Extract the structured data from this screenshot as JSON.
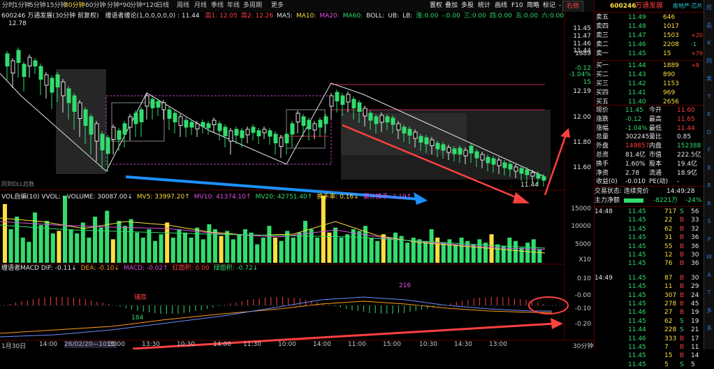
{
  "toolbar": {
    "periods": [
      "分时",
      "1分钟",
      "5分钟",
      "15分钟",
      "30分钟",
      "60分钟",
      "分钟*90",
      "分钟*120",
      "日线",
      "周线",
      "月线",
      "季线",
      "年线",
      "多周期",
      "更多"
    ],
    "selected_period": "30分钟",
    "right_buttons": [
      "置权",
      "叠加",
      "多股",
      "统计",
      "画线",
      "F10",
      "简略",
      "标记",
      "-",
      "+"
    ],
    "right_tab": "右侧"
  },
  "chart": {
    "stock_line": "600246 万通发展(30分钟 前复权)",
    "indicator_line": "缠语者缠论(1,0,0,0,0,0) : 11.44",
    "ma_labels": [
      "高1: 12.05",
      "高2: 12.26",
      "MA5:",
      "MA10:",
      "MA20:",
      "MA60:",
      "BOLL:",
      "UB:",
      "LB:",
      "涨:0.00",
      "-:0.00",
      "三:0.00",
      "四:0.00",
      "五:0.00",
      "六:0.00"
    ],
    "price_high": "12.78",
    "current_tag": "11.44",
    "y_labels": [
      "11.45",
      "11.47",
      "11.46",
      "11.44",
      "1889",
      "-0.12",
      "-1.04%",
      "15",
      "12.19",
      "12.00",
      "11.80",
      "11.60"
    ],
    "bottom_left_label": "同到DLL后数",
    "vol_line": [
      "VOL自编(10) VVOL: - VOLUME: 30087.00↓",
      "MV5: 33997.20↑",
      "MV10: 41374.10↑",
      "MV20: 42751.40↑",
      "换手率: 0.16↓",
      "累计换手: 2.19↑"
    ],
    "vol_y_labels": [
      "15000",
      "10000",
      "5000",
      "X10"
    ],
    "macd_line": [
      "缠语者MACD DIF: -0.11↓",
      "DEA: -0.10↓",
      "MACD: -0.02↑",
      "红面积: 0.00",
      "绿面积: -0.72↓"
    ],
    "macd_y_labels": [
      "0.10",
      "-0.00",
      "-0.10",
      "-0.20"
    ],
    "macd_annotations": {
      "top": "216",
      "bottom": "184",
      "top_left": "铺底"
    },
    "x_labels": [
      "1月30日",
      "14:00",
      "26/02/20—10:30",
      "15:00",
      "13:30",
      "10:30",
      "14:00",
      "11:30",
      "10:00",
      "14:00",
      "11:00",
      "15:00",
      "10:30",
      "14:30",
      "13:00",
      "30分钟"
    ],
    "chart_data": {
      "type": "candlestick",
      "title": "600246 万通发展(30分钟 前复权)",
      "ylim": [
        11.4,
        12.8
      ],
      "last_price": 11.44,
      "high_marks": [
        12.05,
        12.26
      ],
      "series": [
        {
          "name": "VOLUME",
          "last": 30087.0
        },
        {
          "name": "MV5",
          "last": 33997.2
        },
        {
          "name": "MV10",
          "last": 41374.1
        },
        {
          "name": "MV20",
          "last": 42751.4
        },
        {
          "name": "DIF",
          "last": -0.11
        },
        {
          "name": "DEA",
          "last": -0.1
        },
        {
          "name": "MACD",
          "last": -0.02
        }
      ]
    }
  },
  "quote": {
    "code": "600246",
    "name": "万通发展",
    "tag": "房地产·芯片",
    "asks": [
      {
        "label": "卖五",
        "price": "11.49",
        "vol": "646",
        "chg": ""
      },
      {
        "label": "卖四",
        "price": "11.48",
        "vol": "1017",
        "chg": ""
      },
      {
        "label": "卖三",
        "price": "11.47",
        "vol": "1503",
        "chg": "+20"
      },
      {
        "label": "卖二",
        "price": "11.46",
        "vol": "2208",
        "chg": "-1"
      },
      {
        "label": "卖一",
        "price": "11.45",
        "vol": "15",
        "chg": "+79"
      }
    ],
    "bids": [
      {
        "label": "买一",
        "price": "11.44",
        "vol": "1889",
        "chg": "+8"
      },
      {
        "label": "买二",
        "price": "11.43",
        "vol": "890",
        "chg": ""
      },
      {
        "label": "买三",
        "price": "11.42",
        "vol": "1153",
        "chg": ""
      },
      {
        "label": "买四",
        "price": "11.41",
        "vol": "969",
        "chg": ""
      },
      {
        "label": "买五",
        "price": "11.40",
        "vol": "2656",
        "chg": ""
      }
    ],
    "stats": [
      {
        "l1": "现价",
        "v1": "11.45",
        "l2": "今开",
        "v2": "11.60"
      },
      {
        "l1": "涨跌",
        "v1": "-0.12",
        "l2": "最高",
        "v2": "11.65"
      },
      {
        "l1": "涨幅",
        "v1": "-1.04%",
        "l2": "最低",
        "v2": "11.44"
      },
      {
        "l1": "总量",
        "v1": "302245",
        "l2": "量比",
        "v2": "0.85"
      },
      {
        "l1": "外盘",
        "v1": "149857",
        "l2": "内盘",
        "v2": "152388"
      },
      {
        "l1": "总资",
        "v1": "81.4亿",
        "l2": "市值",
        "v2": "222.5亿"
      },
      {
        "l1": "换手",
        "v1": "1.60%",
        "l2": "股本",
        "v2": "19.4亿"
      },
      {
        "l1": "净资",
        "v1": "2.78",
        "l2": "流通",
        "v2": "18.9亿"
      },
      {
        "l1": "收益(0)",
        "v1": "-0.010",
        "l2": "PE(动)",
        "v2": "-"
      }
    ],
    "status": "交易状态: 连续竞价",
    "status_time": "14:49:28",
    "net_flow_label": "主力净额",
    "net_flow_value": "-8221万",
    "net_flow_pct": "-24%",
    "ticks_block1_time": "14:48",
    "ticks1": [
      {
        "p": "11.45",
        "v": "717",
        "f": "S",
        "n": "56"
      },
      {
        "p": "11.45",
        "v": "22",
        "f": "B",
        "n": "33"
      },
      {
        "p": "11.45",
        "v": "62",
        "f": "B",
        "n": "32"
      },
      {
        "p": "11.45",
        "v": "31",
        "f": "B",
        "n": "36"
      },
      {
        "p": "11.45",
        "v": "55",
        "f": "B",
        "n": "36"
      },
      {
        "p": "11.45",
        "v": "12",
        "f": "B",
        "n": "30"
      },
      {
        "p": "11.45",
        "v": "76",
        "f": "B",
        "n": "36"
      }
    ],
    "ticks_block2_time": "14:49",
    "ticks2": [
      {
        "p": "11.45",
        "v": "87",
        "f": "B",
        "n": "30"
      },
      {
        "p": "11.45",
        "v": "11",
        "f": "B",
        "n": "29"
      },
      {
        "p": "11.45",
        "v": "307",
        "f": "B",
        "n": "24"
      },
      {
        "p": "11.45",
        "v": "278",
        "f": "B",
        "n": "45"
      },
      {
        "p": "11.46",
        "v": "27",
        "f": "B",
        "n": "19"
      },
      {
        "p": "11.45",
        "v": "62",
        "f": "S",
        "n": "19"
      },
      {
        "p": "11.44",
        "v": "228",
        "f": "S",
        "n": "21"
      },
      {
        "p": "11.46",
        "v": "333",
        "f": "B",
        "n": "17"
      },
      {
        "p": "11.45",
        "v": "7",
        "f": "B",
        "n": "11"
      },
      {
        "p": "11.45",
        "v": "15",
        "f": "B",
        "n": "14"
      },
      {
        "p": "11.45",
        "v": "5",
        "f": "S",
        "n": "5"
      }
    ]
  },
  "sidebar": {
    "items": [
      "应",
      "品",
      "K",
      "同",
      "类",
      "T",
      "K",
      "D",
      "F",
      "R",
      "R",
      "R",
      "S",
      "P",
      "W",
      "A",
      "T",
      "多",
      "多"
    ]
  }
}
